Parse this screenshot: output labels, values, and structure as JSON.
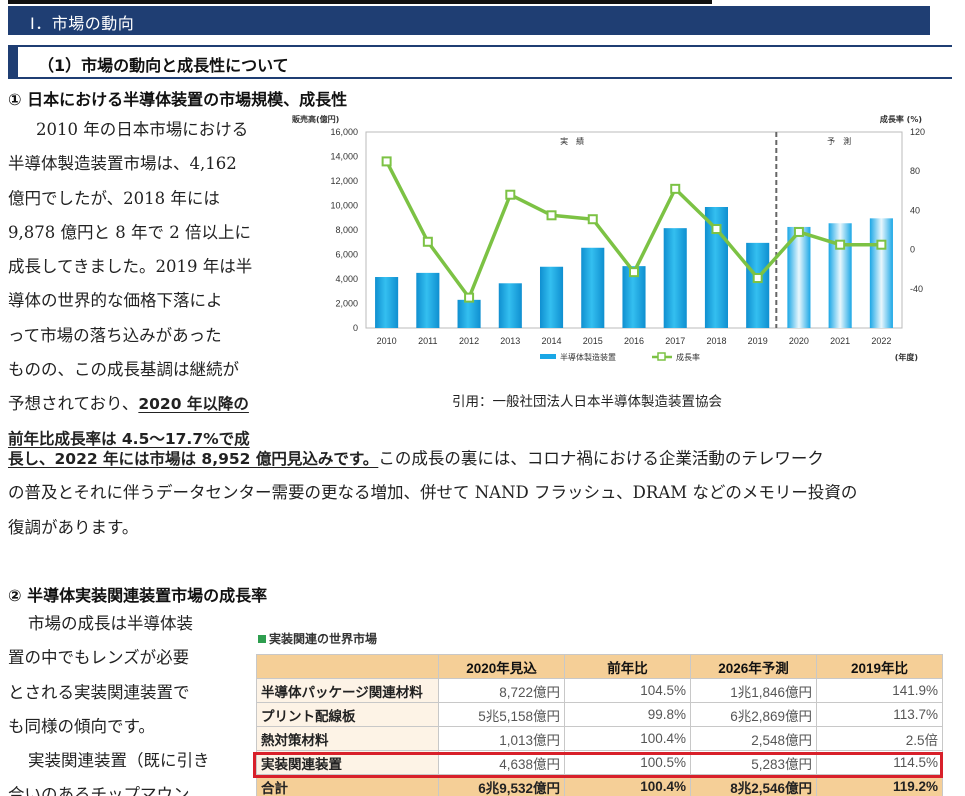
{
  "section_title": "Ⅰ．市場の動向",
  "subsection_title": "（1）市場の動向と成長性について",
  "heading1": "① 日本における半導体装置の市場規模、成長性",
  "para1": {
    "left_lines": [
      "2010 年の日本市場における",
      "半導体製造装置市場は、4,162",
      "億円でしたが、2018 年には",
      "9,878 億円と 8 年で 2 倍以上に",
      "成長してきました。2019 年は半",
      "導体の世界的な価格下落によ",
      "って市場の落ち込みがあった",
      "ものの、この成長基調は継続が"
    ],
    "line9_plain": "予想されており、",
    "line9_underline": "2020 年以降の",
    "line10_underline": "前年比成長率は 4.5〜17.7%で成",
    "line11_underline": "長し、2022 年には市場は 8,952 億円見込みです。",
    "line11_rest": "この成長の裏には、コロナ禍における企業活動のテレワーク",
    "line12": "の普及とそれに伴うデータセンター需要の更なる増加、併せて NAND フラッシュ、DRAM などのメモリー投資の",
    "line13": "復調があります。"
  },
  "citation": "引用：一般社団法人日本半導体製造装置協会",
  "heading2": "② 半導体実装関連装置市場の成長率",
  "para2_lines": [
    "市場の成長は半導体装",
    "置の中でもレンズが必要",
    "とされる実装関連装置で",
    "も同様の傾向です。",
    "実装関連装置（既に引き",
    "合いのあるチップマウン"
  ],
  "chart_data": {
    "type": "bar",
    "left_axis_title": "販売高(億円)",
    "right_axis_title": "成長率 (%)",
    "x_axis_unit": "(年度)",
    "region_labels": [
      "実　績",
      "予　測"
    ],
    "categories": [
      "2010",
      "2011",
      "2012",
      "2013",
      "2014",
      "2015",
      "2016",
      "2017",
      "2018",
      "2019",
      "2020",
      "2021",
      "2022"
    ],
    "series": [
      {
        "name": "半導体製造装置",
        "type": "bar",
        "axis": "left",
        "values": [
          4162,
          4500,
          2300,
          3650,
          5000,
          6550,
          5050,
          8150,
          9878,
          6950,
          8250,
          8550,
          8952
        ]
      },
      {
        "name": "成長率",
        "type": "line",
        "axis": "right",
        "values": [
          90,
          8,
          -49,
          56,
          35,
          31,
          -23,
          62,
          21,
          -29,
          18,
          5,
          5
        ]
      }
    ],
    "forecast_from": "2020",
    "left_ylim": [
      0,
      16000
    ],
    "left_ticks": [
      "0",
      "2,000",
      "4,000",
      "6,000",
      "8,000",
      "10,000",
      "12,000",
      "14,000",
      "16,000"
    ],
    "right_ylim": [
      -80,
      120
    ],
    "right_ticks": [
      "-40",
      "0",
      "40",
      "80",
      "120"
    ],
    "colors": {
      "bar": "#1aa7e6",
      "bar_forecast": "#bfe6f8",
      "line": "#7cc244"
    }
  },
  "table": {
    "title": "実装関連の世界市場",
    "headers": [
      "",
      "2020年見込",
      "前年比",
      "2026年予測",
      "2019年比"
    ],
    "rows": [
      [
        "半導体パッケージ関連材料",
        "8,722億円",
        "104.5%",
        "1兆1,846億円",
        "141.9%"
      ],
      [
        "プリント配線板",
        "5兆5,158億円",
        "99.8%",
        "6兆2,869億円",
        "113.7%"
      ],
      [
        "熱対策材料",
        "1,013億円",
        "100.4%",
        "2,548億円",
        "2.5倍"
      ],
      [
        "実装関連装置",
        "4,638億円",
        "100.5%",
        "5,283億円",
        "114.5%"
      ],
      [
        "合計",
        "6兆9,532億円",
        "100.4%",
        "8兆2,546億円",
        "119.2%"
      ]
    ],
    "highlight_color": "#d8202a"
  }
}
